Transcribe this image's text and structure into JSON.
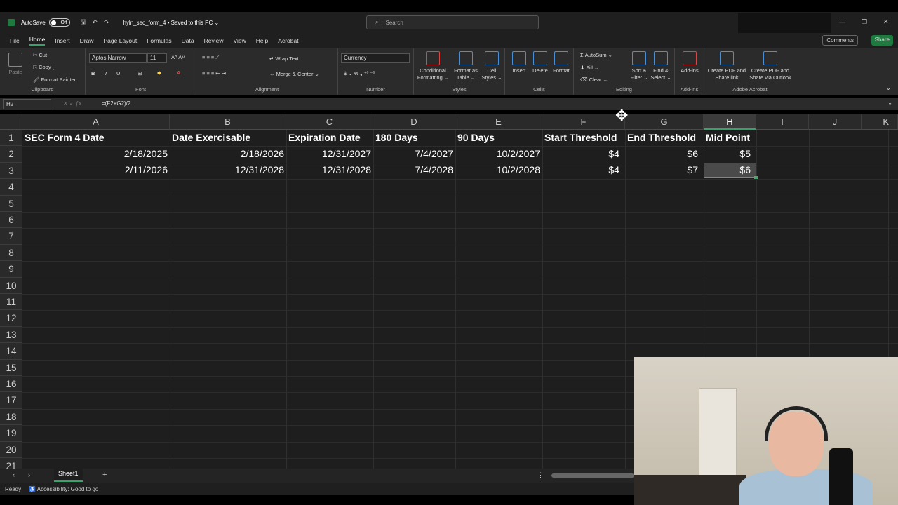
{
  "window": {
    "autosave_label": "AutoSave",
    "autosave_state": "Off",
    "filename": "hyln_sec_form_4 • Saved to this PC ⌄",
    "search_placeholder": "Search"
  },
  "menu": {
    "items": [
      "File",
      "Home",
      "Insert",
      "Draw",
      "Page Layout",
      "Formulas",
      "Data",
      "Review",
      "View",
      "Help",
      "Acrobat"
    ],
    "active": "Home",
    "comments": "Comments",
    "share": "Share"
  },
  "ribbon": {
    "clipboard": {
      "paste": "Paste",
      "cut": "Cut",
      "copy": "Copy",
      "format_painter": "Format Painter",
      "label": "Clipboard"
    },
    "font": {
      "name": "Aptos Narrow",
      "size": "11",
      "label": "Font"
    },
    "alignment": {
      "wrap": "Wrap Text",
      "merge": "Merge & Center",
      "label": "Alignment"
    },
    "number": {
      "format": "Currency",
      "label": "Number"
    },
    "styles": {
      "conditional": "Conditional Formatting ⌄",
      "format_table": "Format as Table ⌄",
      "cell_styles": "Cell Styles ⌄",
      "label": "Styles"
    },
    "cells": {
      "insert": "Insert",
      "delete": "Delete",
      "format": "Format",
      "label": "Cells"
    },
    "editing": {
      "autosum": "AutoSum",
      "fill": "Fill ⌄",
      "clear": "Clear ⌄",
      "sort": "Sort & Filter ⌄",
      "find": "Find & Select ⌄",
      "label": "Editing"
    },
    "addins": {
      "addins": "Add-ins",
      "label": "Add-ins"
    },
    "acrobat": {
      "create_pdf": "Create PDF and Share link",
      "create_outlook": "Create PDF and Share via Outlook",
      "label": "Adobe Acrobat"
    }
  },
  "formula_bar": {
    "name_box": "H2",
    "formula": "=(F2+G2)/2"
  },
  "columns": [
    "A",
    "B",
    "C",
    "D",
    "E",
    "F",
    "G",
    "H",
    "I",
    "J",
    "K"
  ],
  "selected_column": "H",
  "rows": [
    "1",
    "2",
    "3",
    "4",
    "5",
    "6",
    "7",
    "8",
    "9",
    "10",
    "11",
    "12",
    "13",
    "14",
    "15",
    "16",
    "17",
    "18",
    "19",
    "20",
    "21"
  ],
  "table": {
    "headers": [
      "SEC Form 4 Date",
      "Date Exercisable",
      "Expiration Date",
      "180 Days",
      "90 Days",
      "Start Threshold",
      "End Threshold",
      "Mid Point"
    ],
    "rows": [
      [
        "2/18/2025",
        "2/18/2026",
        "12/31/2027",
        "7/4/2027",
        "10/2/2027",
        "$4",
        "$6",
        "$5"
      ],
      [
        "2/11/2026",
        "12/31/2028",
        "12/31/2028",
        "7/4/2028",
        "10/2/2028",
        "$4",
        "$7",
        "$6"
      ]
    ]
  },
  "sheet_tab": "Sheet1",
  "status": {
    "ready": "Ready",
    "accessibility": "Accessibility: Good to go"
  }
}
